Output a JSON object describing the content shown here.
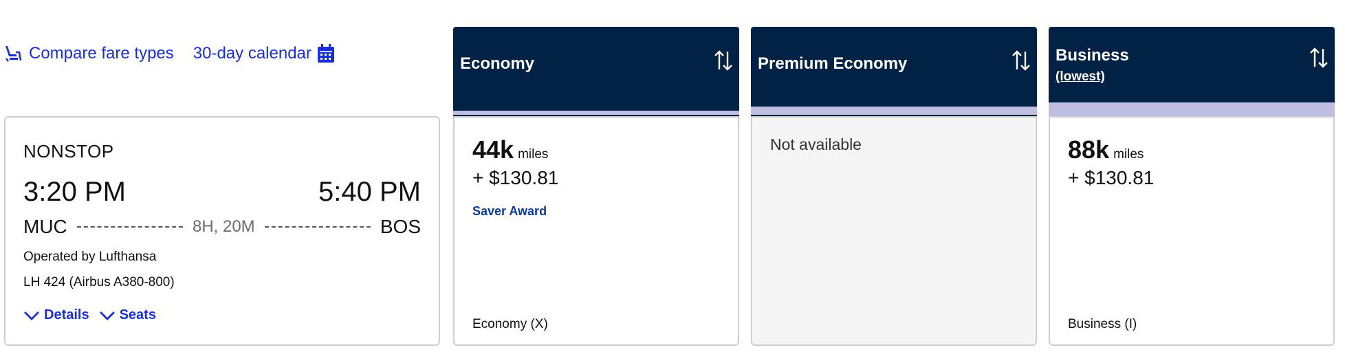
{
  "links": {
    "compare_fares": "Compare fare types",
    "calendar": "30-day calendar"
  },
  "flight": {
    "stops": "NONSTOP",
    "depart_time": "3:20 PM",
    "arrive_time": "5:40 PM",
    "origin": "MUC",
    "destination": "BOS",
    "duration": "8H, 20M",
    "operated_by": "Operated by Lufthansa",
    "flight_number": "LH 424 (Airbus A380-800)",
    "details_label": "Details",
    "seats_label": "Seats"
  },
  "columns": [
    {
      "title": "Economy",
      "subtitle": ""
    },
    {
      "title": "Premium Economy",
      "subtitle": ""
    },
    {
      "title": "Business",
      "subtitle": "(lowest)"
    }
  ],
  "fares": {
    "economy": {
      "miles": "44k",
      "miles_unit": "miles",
      "taxes": "+ $130.81",
      "award": "Saver Award",
      "cabin_code": "Economy (X)"
    },
    "premium": {
      "status": "Not available"
    },
    "business": {
      "miles": "88k",
      "miles_unit": "miles",
      "taxes": "+ $130.81",
      "cabin_code": "Business (I)"
    }
  },
  "colors": {
    "header_bg": "#012244",
    "accent_link": "#1a2fd6",
    "stripe": "#bdbee0"
  },
  "icons": {
    "compare": "seat-icon",
    "calendar": "calendar-icon",
    "sort": "sort-arrows-icon",
    "expand": "chevron-down-icon"
  }
}
